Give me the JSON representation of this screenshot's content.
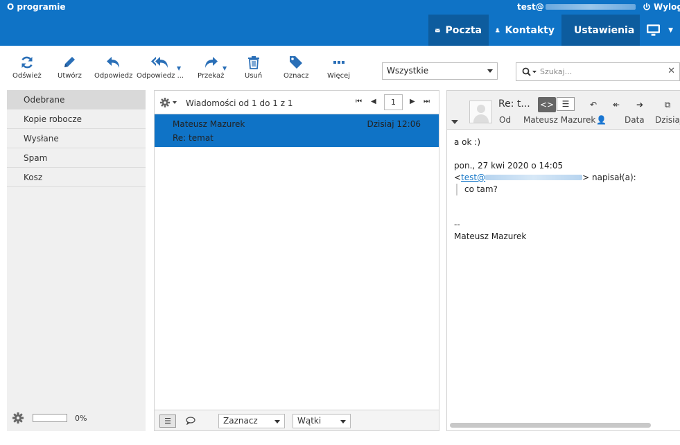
{
  "topbar": {
    "about_label": "O programie",
    "user_prefix": "test@",
    "logout_label": "Wylogu",
    "nav": {
      "mail_label": "Poczta",
      "contacts_label": "Kontakty",
      "settings_label": "Ustawienia"
    },
    "colors": {
      "brand": "#0f73c6",
      "active": "#0d5c9e"
    }
  },
  "toolbar": {
    "refresh_label": "Odśwież",
    "compose_label": "Utwórz",
    "reply_label": "Odpowiedz",
    "reply_all_label": "Odpowiedz ...",
    "forward_label": "Przekaż",
    "delete_label": "Usuń",
    "mark_label": "Oznacz",
    "more_label": "Więcej",
    "filter_value": "Wszystkie",
    "search_placeholder": "Szukaj..."
  },
  "folders": {
    "items": [
      {
        "label": "Odebrane",
        "selected": true
      },
      {
        "label": "Kopie robocze"
      },
      {
        "label": "Wysłane"
      },
      {
        "label": "Spam"
      },
      {
        "label": "Kosz"
      }
    ],
    "quota_percent": "0%"
  },
  "message_list": {
    "title": "Wiadomości od 1 do 1 z 1",
    "page": "1",
    "messages": [
      {
        "from": "Mateusz Mazurek",
        "date": "Dzisiaj 12:06",
        "subject": "Re: temat"
      }
    ],
    "select_label": "Zaznacz",
    "threads_label": "Wątki"
  },
  "preview": {
    "subject": "Re: t...",
    "from_label": "Od",
    "from_value": "Mateusz Mazurek",
    "date_label": "Data",
    "date_value": "Dzisiaj",
    "body": {
      "line1": "a ok :)",
      "quote_header": "pon., 27 kwi 2020 o 14:05",
      "quote_from_prefix": "<",
      "quote_email": "test@",
      "quote_from_suffix": "> napisał(a):",
      "quoted_text": "co tam?",
      "sig_sep": "--",
      "signature": "Mateusz Mazurek"
    }
  }
}
